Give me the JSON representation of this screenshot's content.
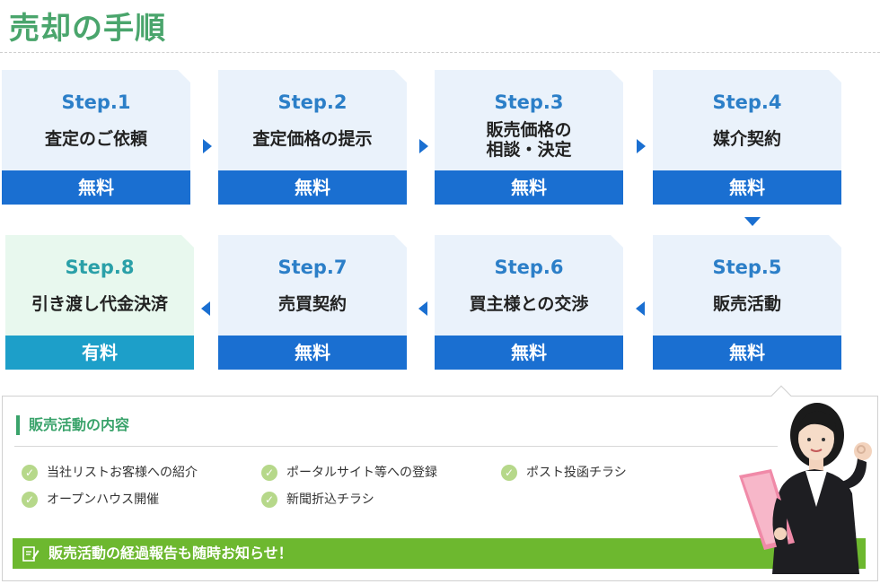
{
  "page": {
    "title": "売却の手順"
  },
  "steps": [
    {
      "num": "Step.1",
      "label": "査定のご依頼",
      "price": "無料"
    },
    {
      "num": "Step.2",
      "label": "査定価格の提示",
      "price": "無料"
    },
    {
      "num": "Step.3",
      "label_line1": "販売価格の",
      "label_line2": "相談・決定",
      "price": "無料"
    },
    {
      "num": "Step.4",
      "label": "媒介契約",
      "price": "無料"
    },
    {
      "num": "Step.5",
      "label": "販売活動",
      "price": "無料"
    },
    {
      "num": "Step.6",
      "label": "買主様との交渉",
      "price": "無料"
    },
    {
      "num": "Step.7",
      "label": "売買契約",
      "price": "無料"
    },
    {
      "num": "Step.8",
      "label": "引き渡し代金決済",
      "price": "有料"
    }
  ],
  "details": {
    "heading": "販売活動の内容",
    "activities": [
      "当社リストお客様への紹介",
      "ポータルサイト等への登録",
      "ポスト投函チラシ",
      "オープンハウス開催",
      "新聞折込チラシ"
    ],
    "report": "販売活動の経過報告も随時お知らせ！"
  },
  "colors": {
    "title_green": "#4aa56c",
    "step_blue": "#1a6fd1",
    "paid_blue": "#1d9fc9",
    "card_bg": "#eaf2fb",
    "report_green": "#6db82f"
  },
  "icons": {
    "check": "check-circle-icon",
    "report": "memo-pencil-icon",
    "arrow_right": "triangle-right-icon",
    "arrow_left": "triangle-left-icon",
    "arrow_down": "triangle-down-icon"
  }
}
